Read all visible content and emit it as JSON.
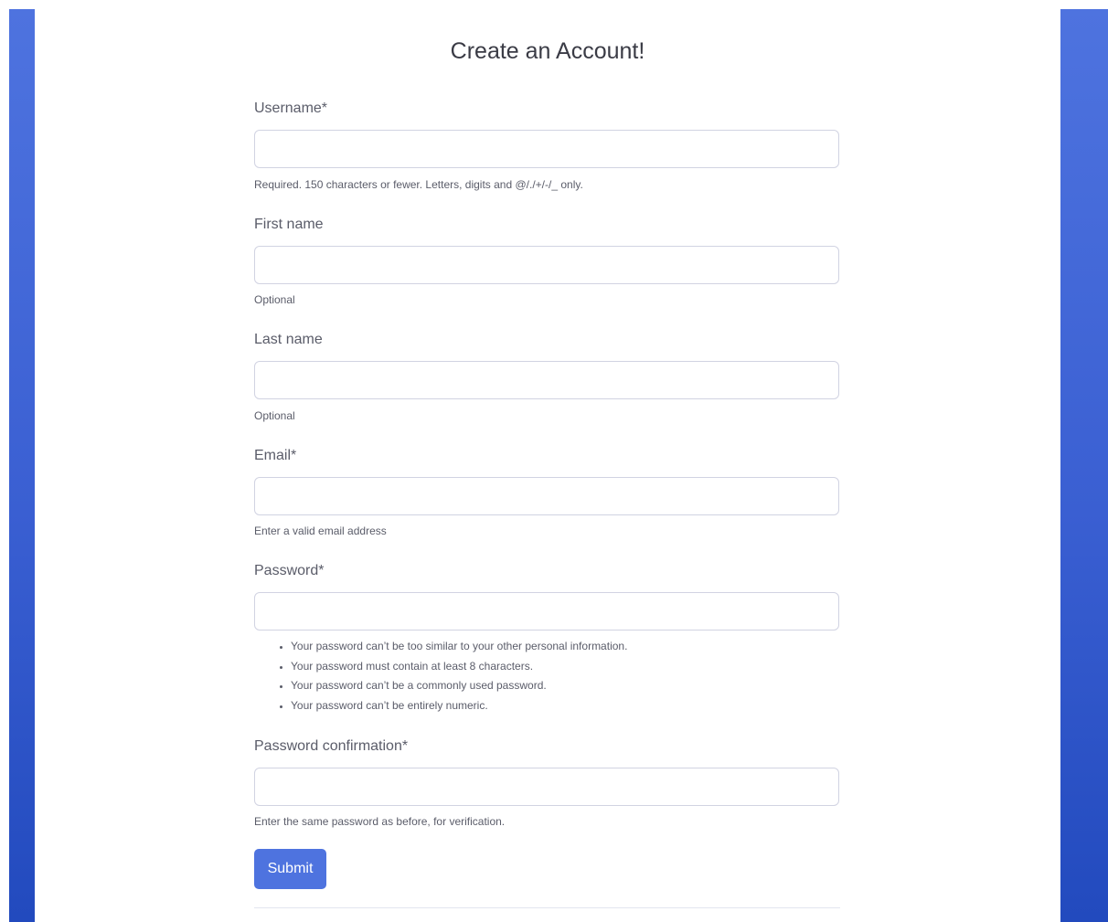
{
  "title": "Create an Account!",
  "fields": [
    {
      "label": "Username*",
      "value": "",
      "help": "Required. 150 characters or fewer. Letters, digits and @/./+/-/_ only."
    },
    {
      "label": "First name",
      "value": "",
      "help": "Optional"
    },
    {
      "label": "Last name",
      "value": "",
      "help": "Optional"
    },
    {
      "label": "Email*",
      "value": "",
      "help": "Enter a valid email address"
    },
    {
      "label": "Password*",
      "value": ""
    },
    {
      "label": "Password confirmation*",
      "value": "",
      "help": "Enter the same password as before, for verification."
    }
  ],
  "password_rules": [
    "Your password can’t be too similar to your other personal information.",
    "Your password must contain at least 8 characters.",
    "Your password can’t be a commonly used password.",
    "Your password can’t be entirely numeric."
  ],
  "submit_label": "Submit",
  "colors": {
    "primary": "#4e73df",
    "sidebar_gradient_top": "#4e73df",
    "sidebar_gradient_bottom": "#224abe"
  }
}
